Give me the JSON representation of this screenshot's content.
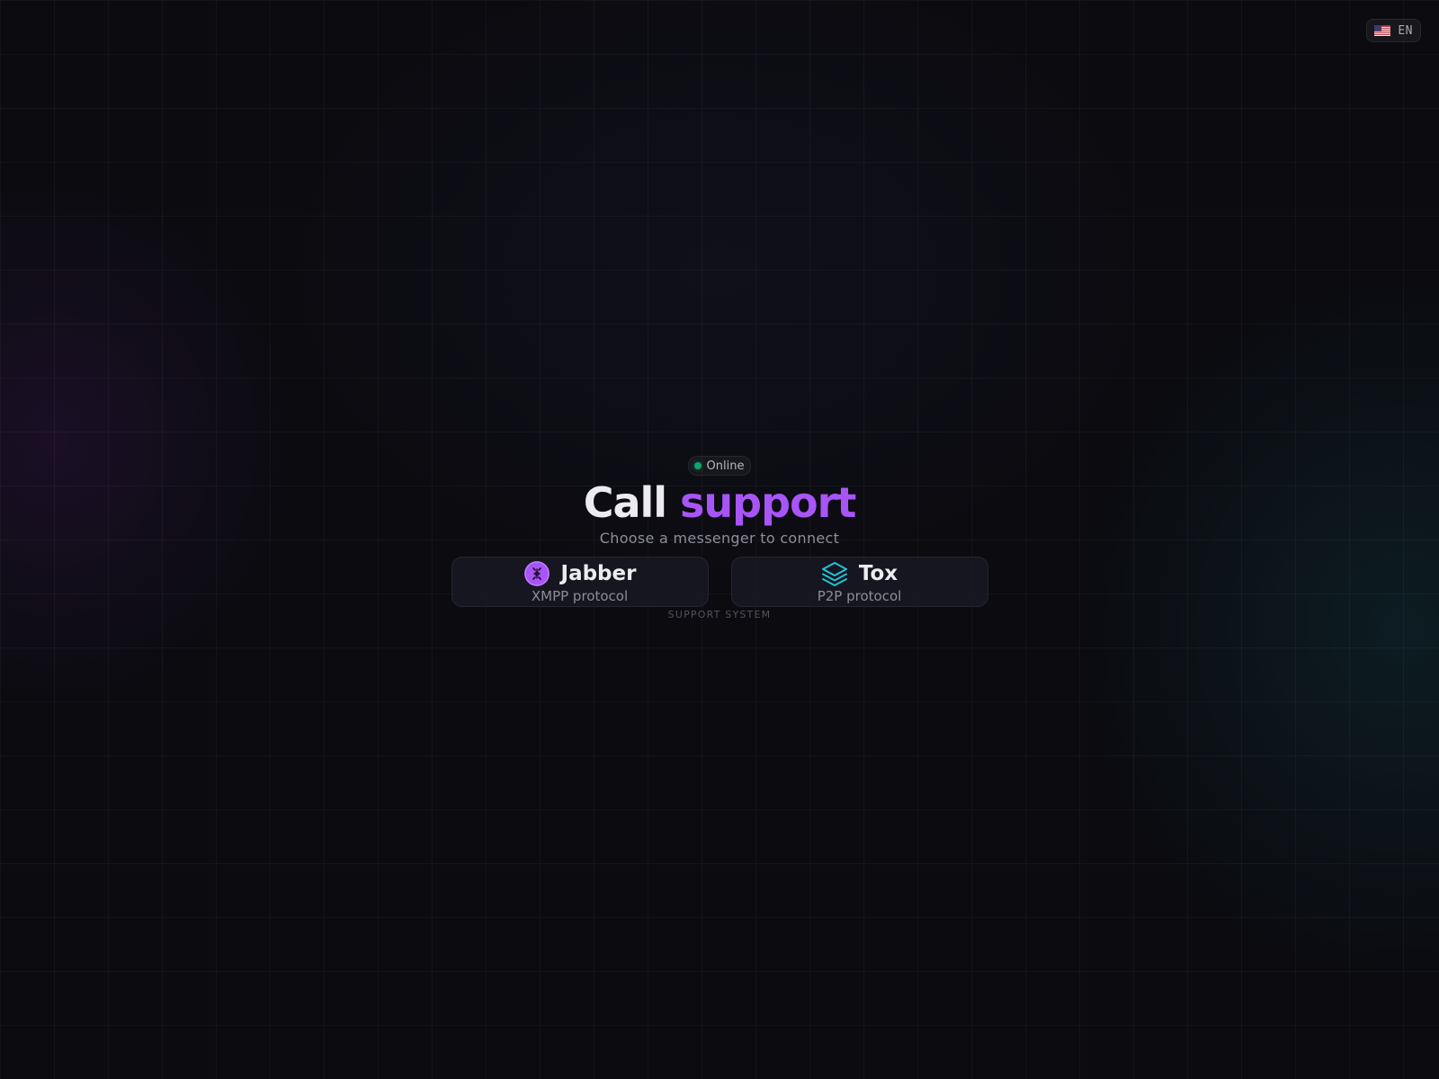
{
  "language": {
    "flag_icon": "us-flag-icon",
    "label": "EN"
  },
  "status": {
    "label": "Online",
    "dot_color": "#10a36b"
  },
  "hero": {
    "title_plain": "Call",
    "title_accent": "support",
    "accent_color": "#a855f7",
    "subtitle": "Choose a messenger to connect"
  },
  "messengers": [
    {
      "name": "Jabber",
      "protocol": "XMPP protocol",
      "icon": "jabber-icon",
      "icon_color": "#a855f7"
    },
    {
      "name": "Tox",
      "protocol": "P2P protocol",
      "icon": "layers-icon",
      "icon_color": "#22c3d8"
    }
  ],
  "footer": {
    "label": "SUPPORT SYSTEM"
  }
}
